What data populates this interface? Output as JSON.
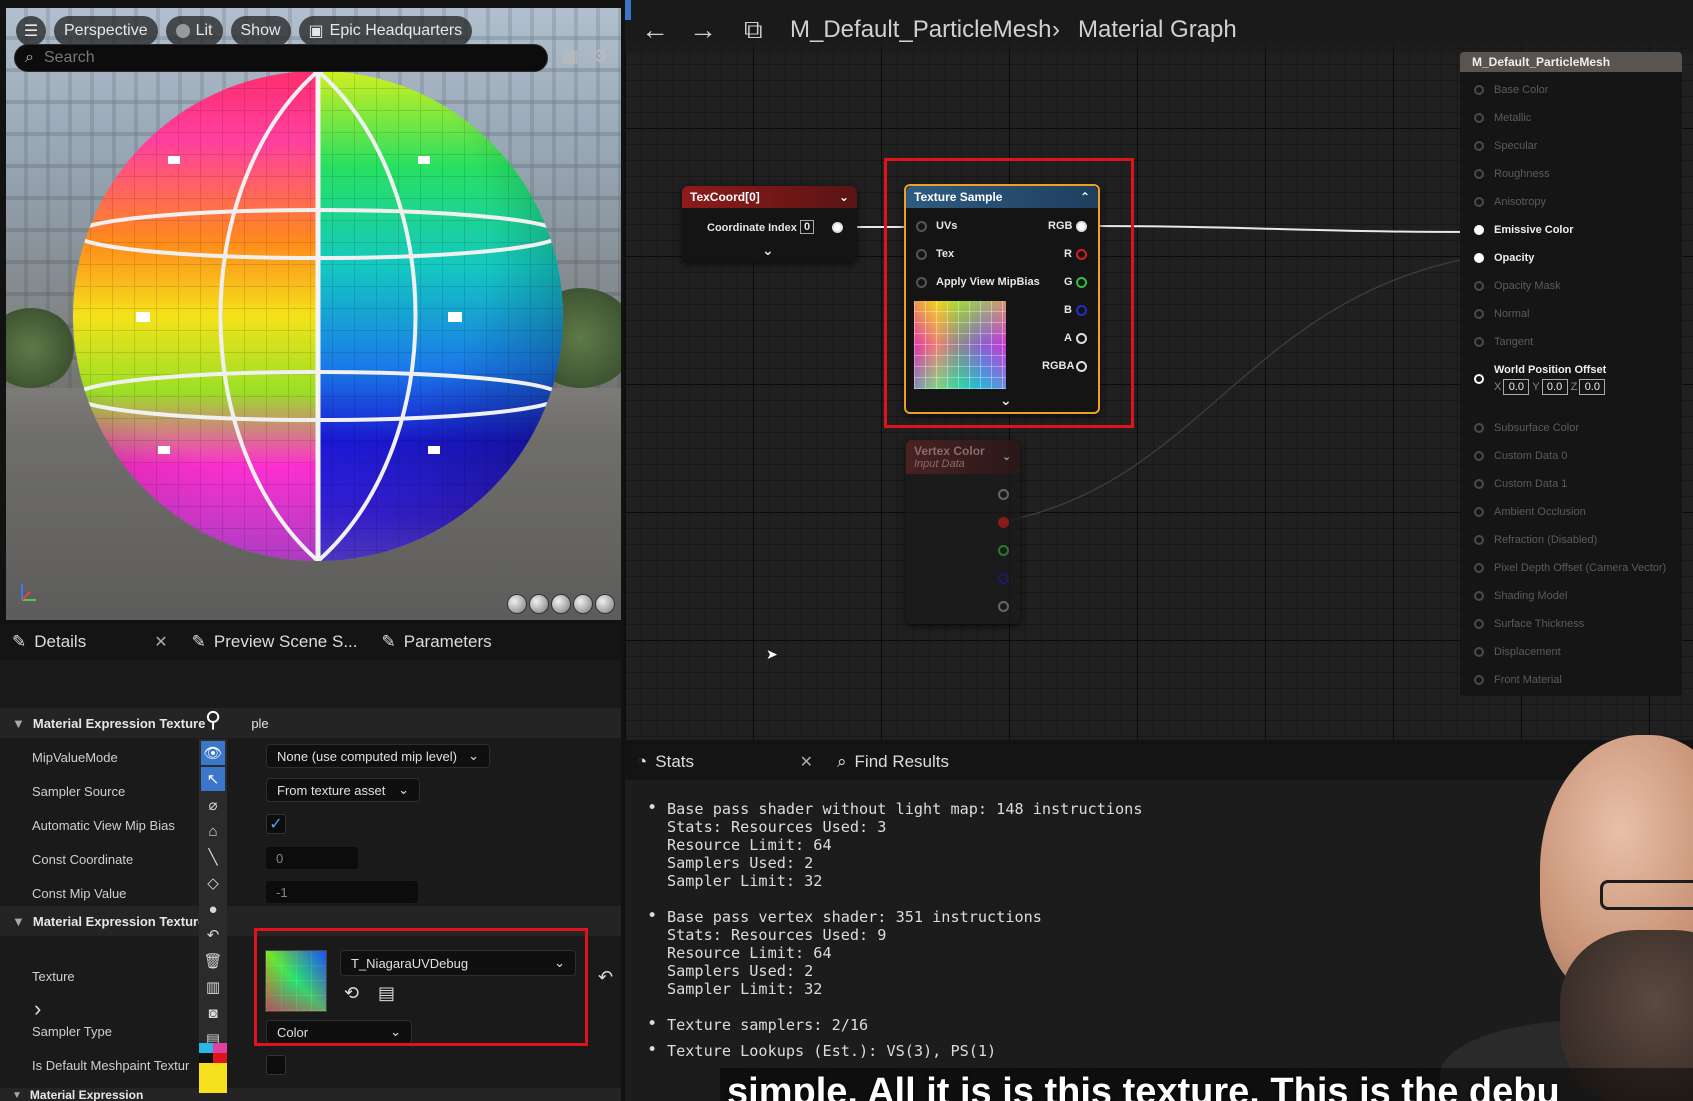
{
  "viewport": {
    "buttons": [
      "Perspective",
      "Lit",
      "Show",
      "Epic Headquarters"
    ]
  },
  "graph": {
    "breadcrumb": [
      "M_Default_ParticleMesh",
      "Material Graph"
    ],
    "texcoord_node": {
      "title": "TexCoord[0]",
      "coordinate_label": "Coordinate Index",
      "coordinate_value": "0"
    },
    "texture_sample_node": {
      "title": "Texture Sample",
      "inputs": [
        "UVs",
        "Tex",
        "Apply View MipBias"
      ],
      "outputs": [
        "RGB",
        "R",
        "G",
        "B",
        "A",
        "RGBA"
      ]
    },
    "vertex_color_node": {
      "title": "Vertex Color",
      "subtitle": "Input Data"
    },
    "result_node": {
      "title": "M_Default_ParticleMesh",
      "inputs": [
        "Base Color",
        "Metallic",
        "Specular",
        "Roughness",
        "Anisotropy",
        "Emissive Color",
        "Opacity",
        "Opacity Mask",
        "Normal",
        "Tangent",
        "World Position Offset",
        "Subsurface Color",
        "Custom Data 0",
        "Custom Data 1",
        "Ambient Occlusion",
        "Refraction (Disabled)",
        "Pixel Depth Offset (Camera Vector)",
        "Shading Model",
        "Surface Thickness",
        "Displacement",
        "Front Material"
      ],
      "wpo": {
        "x_label": "X",
        "x": "0.0",
        "y_label": "Y",
        "y": "0.0",
        "z_label": "Z",
        "z": "0.0"
      }
    }
  },
  "details": {
    "tabs": [
      "Details",
      "Preview Scene S...",
      "Parameters"
    ],
    "search_placeholder": "Search",
    "section1": "Material Expression Texture",
    "section1_tail": "ple",
    "section2": "Material Expression Texture",
    "section3": "Material Expression",
    "props": {
      "mip_value_mode": "MipValueMode",
      "mip_value_mode_value": "None (use computed mip level)",
      "sampler_source": "Sampler Source",
      "sampler_source_value": "From texture asset",
      "auto_view_mip_bias": "Automatic View Mip Bias",
      "const_coordinate": "Const Coordinate",
      "const_coordinate_value": "0",
      "const_mip_value": "Const Mip Value",
      "const_mip_value_value": "-1",
      "texture": "Texture",
      "texture_value": "T_NiagaraUVDebug",
      "sampler_type": "Sampler Type",
      "sampler_type_value": "Color",
      "is_default_meshpaint": "Is Default Meshpaint Textur"
    }
  },
  "stats": {
    "tabs": [
      "Stats",
      "Find Results"
    ],
    "entries": [
      [
        "Base pass shader without light map: 148 instructions",
        "Stats: Resources Used: 3",
        "Resource Limit: 64",
        "Samplers Used: 2",
        "Sampler Limit: 32"
      ],
      [
        "Base pass vertex shader: 351 instructions",
        "Stats: Resources Used: 9",
        "Resource Limit: 64",
        "Samplers Used: 2",
        "Sampler Limit: 32"
      ],
      [
        "Texture samplers: 2/16"
      ],
      [
        "Texture Lookups (Est.): VS(3), PS(1)"
      ]
    ]
  },
  "subtitle": "simple. All it is is this texture. This is the debu",
  "colors": {
    "highlight": "#e0121b",
    "texcoord_header": "#8e1b1b",
    "texture_sample_header": "#2f5b82",
    "selection": "#f0a020"
  }
}
